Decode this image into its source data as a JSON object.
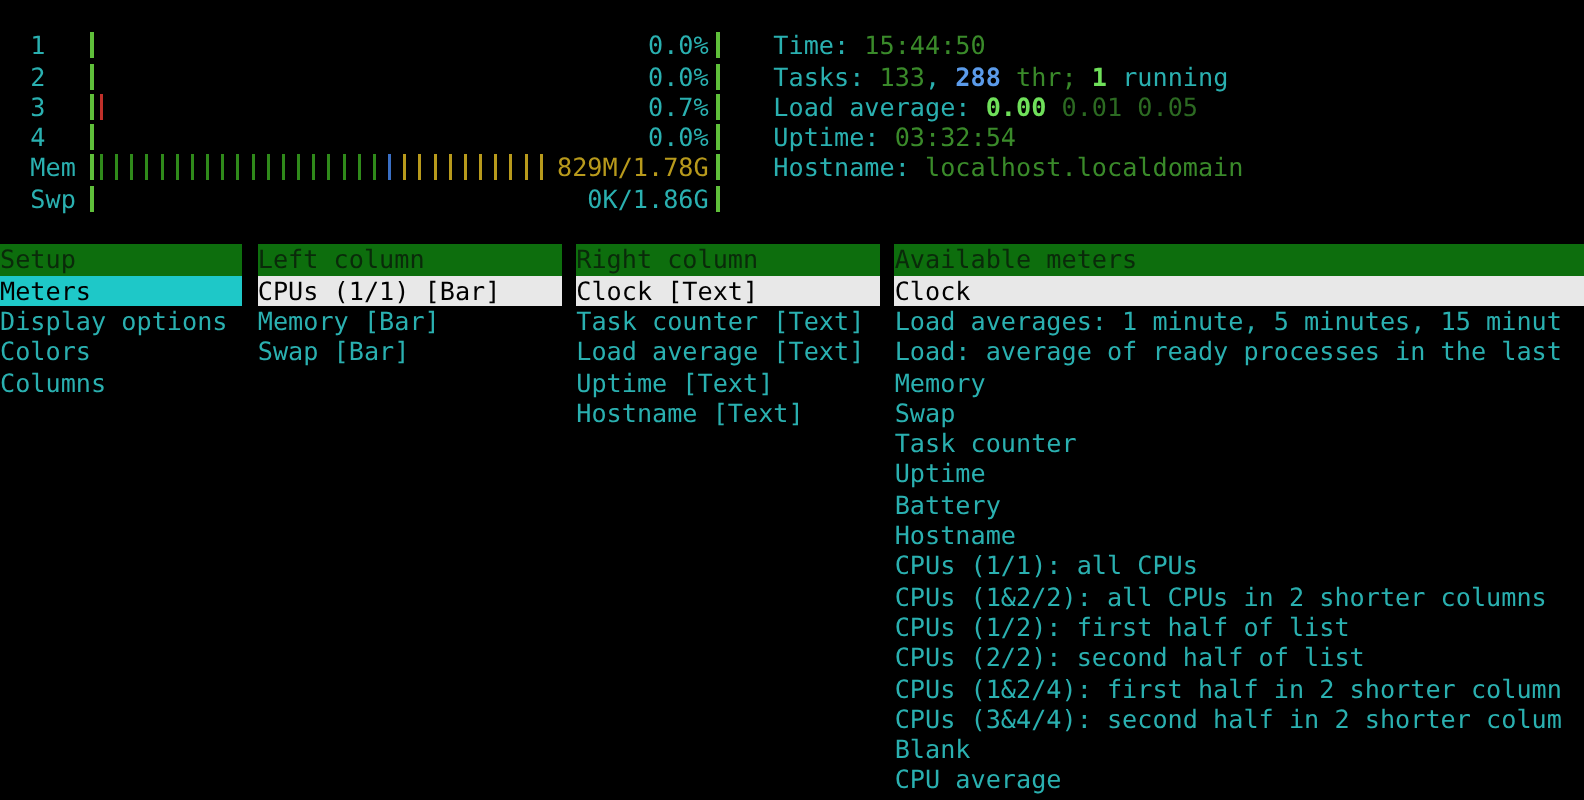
{
  "cpu_meters": [
    {
      "label": "1",
      "reading": "0.0%"
    },
    {
      "label": "2",
      "reading": "0.0%"
    },
    {
      "label": "3",
      "level": 0.007,
      "reading": "0.7%"
    },
    {
      "label": "4",
      "reading": "0.0%"
    }
  ],
  "memory": {
    "label": "Mem",
    "level": 0.73,
    "reading": "829M/1.78G"
  },
  "swap": {
    "label": "Swp",
    "reading": "0K/1.86G"
  },
  "info": [
    {
      "label": "Time:",
      "parts": [
        {
          "text": "15:44:50",
          "kind": "value"
        }
      ]
    },
    {
      "label": "Tasks:",
      "parts": [
        {
          "text": "133",
          "kind": "value"
        },
        {
          "text": ",",
          "kind": "separator"
        },
        {
          "text": "288",
          "kind": "accent"
        },
        {
          "text": "thr;",
          "kind": "value"
        },
        {
          "text": "1",
          "kind": "highlight"
        },
        {
          "text": "running",
          "kind": "plain"
        }
      ]
    },
    {
      "label": "Load average:",
      "parts": [
        {
          "text": "0.00",
          "kind": "highlight"
        },
        {
          "text": "0.01",
          "kind": "dim"
        },
        {
          "text": "0.05",
          "kind": "dim"
        }
      ]
    },
    {
      "label": "Uptime:",
      "parts": [
        {
          "text": "03:32:54",
          "kind": "value"
        }
      ]
    },
    {
      "label": "Hostname:",
      "parts": [
        {
          "text": "localhost.localdomain",
          "kind": "value"
        }
      ]
    }
  ],
  "panels": [
    {
      "header": "Setup",
      "focused": true,
      "items": [
        {
          "label": "Meters",
          "selected": true
        },
        {
          "label": "Display options",
          "selected": false
        },
        {
          "label": "Colors",
          "selected": false
        },
        {
          "label": "Columns",
          "selected": false
        }
      ]
    },
    {
      "header": "Left column",
      "focused": false,
      "items": [
        {
          "label": "CPUs (1/1) [Bar]",
          "selected": true
        },
        {
          "label": "Memory [Bar]",
          "selected": false
        },
        {
          "label": "Swap [Bar]",
          "selected": false
        }
      ]
    },
    {
      "header": "Right column",
      "focused": false,
      "items": [
        {
          "label": "Clock [Text]",
          "selected": true
        },
        {
          "label": "Task counter [Text]",
          "selected": false
        },
        {
          "label": "Load average [Text]",
          "selected": false
        },
        {
          "label": "Uptime [Text]",
          "selected": false
        },
        {
          "label": "Hostname [Text]",
          "selected": false
        }
      ]
    },
    {
      "header": "Available meters",
      "focused": false,
      "items": [
        {
          "label": "Clock",
          "selected": true
        },
        {
          "label": "Load averages: 1 minute, 5 minutes, 15 minut",
          "selected": false
        },
        {
          "label": "Load: average of ready processes in the last",
          "selected": false
        },
        {
          "label": "Memory",
          "selected": false
        },
        {
          "label": "Swap",
          "selected": false
        },
        {
          "label": "Task counter",
          "selected": false
        },
        {
          "label": "Uptime",
          "selected": false
        },
        {
          "label": "Battery",
          "selected": false
        },
        {
          "label": "Hostname",
          "selected": false
        },
        {
          "label": "CPUs (1/1): all CPUs",
          "selected": false
        },
        {
          "label": "CPUs (1&2/2): all CPUs in 2 shorter columns",
          "selected": false
        },
        {
          "label": "CPUs (1/2): first half of list",
          "selected": false
        },
        {
          "label": "CPUs (2/2): second half of list",
          "selected": false
        },
        {
          "label": "CPUs (1&2/4): first half in 2 shorter column",
          "selected": false
        },
        {
          "label": "CPUs (3&4/4): second half in 2 shorter colum",
          "selected": false
        },
        {
          "label": "Blank",
          "selected": false
        },
        {
          "label": "CPU average",
          "selected": false
        }
      ]
    }
  ]
}
